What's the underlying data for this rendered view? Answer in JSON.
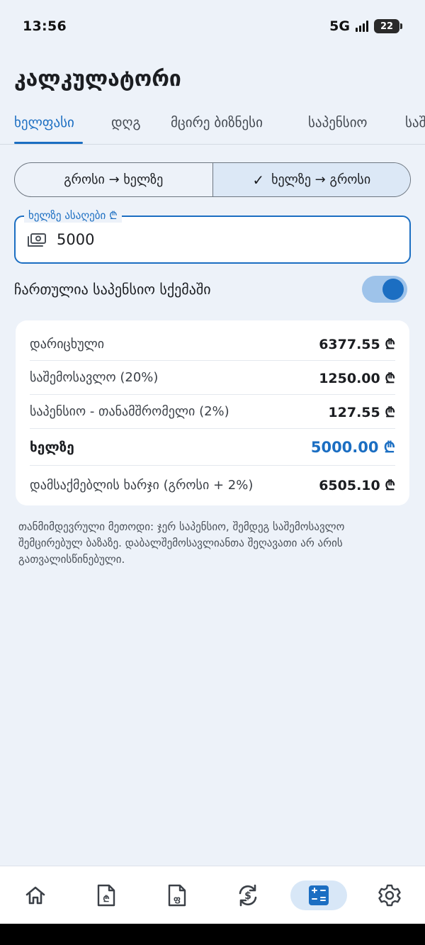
{
  "status_bar": {
    "time": "13:56",
    "network": "5G",
    "battery": "22"
  },
  "page": {
    "title": "კალკულატორი"
  },
  "tabs": [
    {
      "label": "ხელფასი",
      "active": true
    },
    {
      "label": "დღგ"
    },
    {
      "label": "მცირე ბიზნესი"
    },
    {
      "label": "საპენსიო"
    },
    {
      "label": "საშემოსავლო"
    }
  ],
  "mode": {
    "gross_to_net": "გროსი → ხელზე",
    "net_to_gross": "ხელზე → გროსი",
    "selected_check": "✓"
  },
  "input": {
    "label": "ხელზე ასაღები ₾",
    "value": "5000"
  },
  "pension_toggle": {
    "label": "ჩართულია საპენსიო სქემაში",
    "on": true
  },
  "results": {
    "accrued": {
      "label": "დარიცხული",
      "value": "6377.55 ₾"
    },
    "income_tax": {
      "label": "საშემოსავლო (20%)",
      "value": "1250.00 ₾"
    },
    "pension_employee": {
      "label": "საპენსიო - თანამშრომელი (2%)",
      "value": "127.55 ₾"
    },
    "net": {
      "label": "ხელზე",
      "value": "5000.00 ₾"
    },
    "employer_cost": {
      "label": "დამსაქმებლის ხარჯი (გროსი + 2%)",
      "value": "6505.10 ₾"
    }
  },
  "footnote": "თანმიმდევრული მეთოდი: ჯერ საპენსიო, შემდეგ საშემოსავლო შემცირებულ ბაზაზე. დაბალშემოსავლიანთა შეღავათი არ არის გათვალისწინებული.",
  "colors": {
    "accent": "#1b6ec2",
    "background": "#edf2f9"
  },
  "bottom_nav": [
    {
      "icon": "home-icon"
    },
    {
      "icon": "document-lari-icon"
    },
    {
      "icon": "document-vat-icon"
    },
    {
      "icon": "currency-exchange-icon"
    },
    {
      "icon": "calculator-icon",
      "active": true
    },
    {
      "icon": "gear-icon"
    }
  ]
}
